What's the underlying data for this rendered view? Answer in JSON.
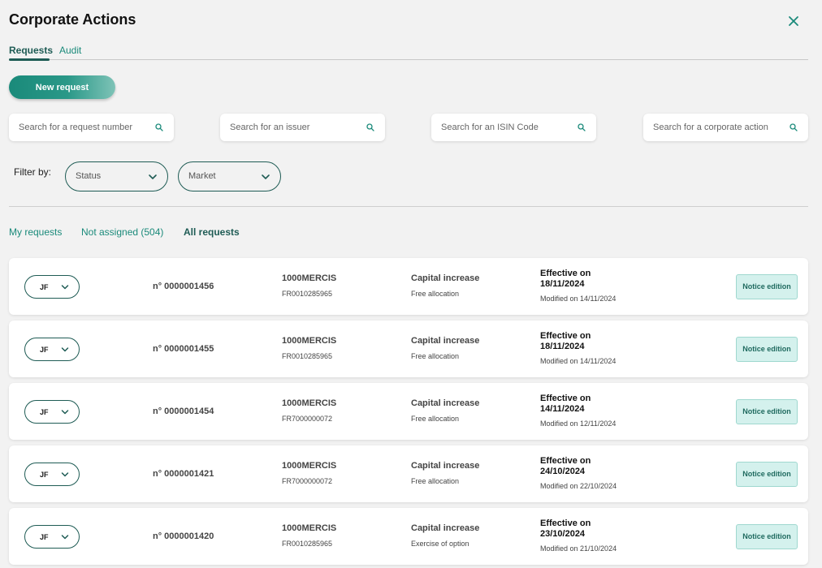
{
  "header": {
    "title": "Corporate Actions"
  },
  "tabs": [
    {
      "label": "Requests",
      "active": true
    },
    {
      "label": "Audit",
      "active": false
    }
  ],
  "new_request_label": "New request",
  "search": {
    "request_number_placeholder": "Search for a request number",
    "issuer_placeholder": "Search for an issuer",
    "isin_placeholder": "Search for an ISIN Code",
    "corporate_action_placeholder": "Search for a corporate action"
  },
  "filters": {
    "label": "Filter by:",
    "status": "Status",
    "market": "Market"
  },
  "subtabs": [
    {
      "label": "My requests",
      "active": false
    },
    {
      "label": "Not assigned (504)",
      "active": false
    },
    {
      "label": "All requests",
      "active": true
    }
  ],
  "colors": {
    "accent": "#1a8a7a",
    "accent_dark": "#1f5c55",
    "badge_bg": "#d4f1ed"
  },
  "requests": [
    {
      "assignee": "JF",
      "number": "n° 0000001456",
      "issuer": "1000MERCIS",
      "isin": "FR0010285965",
      "action": "Capital increase",
      "subaction": "Free allocation",
      "effective_label": "Effective on",
      "effective_date": "18/11/2024",
      "modified": "Modified on 14/11/2024",
      "status": "Notice edition"
    },
    {
      "assignee": "JF",
      "number": "n° 0000001455",
      "issuer": "1000MERCIS",
      "isin": "FR0010285965",
      "action": "Capital increase",
      "subaction": "Free allocation",
      "effective_label": "Effective on",
      "effective_date": "18/11/2024",
      "modified": "Modified on 14/11/2024",
      "status": "Notice edition"
    },
    {
      "assignee": "JF",
      "number": "n° 0000001454",
      "issuer": "1000MERCIS",
      "isin": "FR7000000072",
      "action": "Capital increase",
      "subaction": "Free allocation",
      "effective_label": "Effective on",
      "effective_date": "14/11/2024",
      "modified": "Modified on 12/11/2024",
      "status": "Notice edition"
    },
    {
      "assignee": "JF",
      "number": "n° 0000001421",
      "issuer": "1000MERCIS",
      "isin": "FR7000000072",
      "action": "Capital increase",
      "subaction": "Free allocation",
      "effective_label": "Effective on",
      "effective_date": "24/10/2024",
      "modified": "Modified on 22/10/2024",
      "status": "Notice edition"
    },
    {
      "assignee": "JF",
      "number": "n° 0000001420",
      "issuer": "1000MERCIS",
      "isin": "FR0010285965",
      "action": "Capital increase",
      "subaction": "Exercise of option",
      "effective_label": "Effective on",
      "effective_date": "23/10/2024",
      "modified": "Modified on 21/10/2024",
      "status": "Notice edition"
    }
  ]
}
